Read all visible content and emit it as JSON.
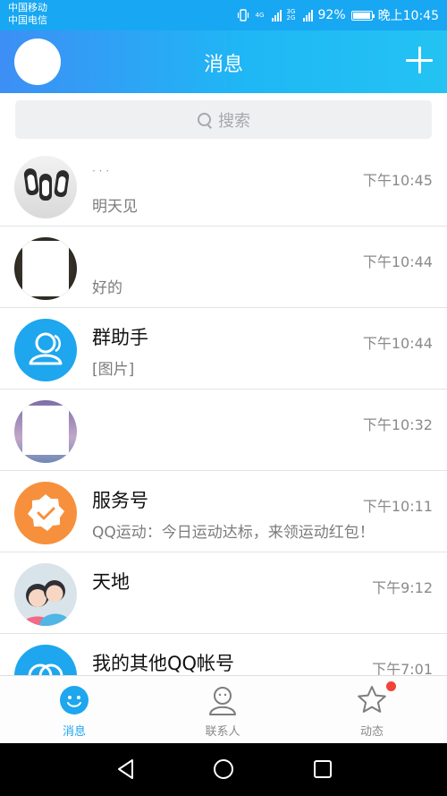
{
  "status_bar": {
    "carrier1": "中国移动",
    "carrier2": "中国电信",
    "net1": "4G",
    "net2": "3G",
    "net2b": "2G",
    "battery": "92%",
    "time": "晚上10:45"
  },
  "header": {
    "title": "消息"
  },
  "search": {
    "placeholder": "搜索"
  },
  "conversations": [
    {
      "name": "· · ·",
      "message": "明天见",
      "time": "下午10:45"
    },
    {
      "name": "",
      "message": "好的",
      "time": "下午10:44"
    },
    {
      "name": "群助手",
      "message": "[图片]",
      "time": "下午10:44"
    },
    {
      "name": "",
      "message": "",
      "time": "下午10:32"
    },
    {
      "name": "服务号",
      "message": "QQ运动：今日运动达标，来领运动红包！",
      "time": "下午10:11"
    },
    {
      "name": "天地",
      "message": "",
      "time": "下午9:12"
    },
    {
      "name": "我的其他QQ帐号",
      "message": "",
      "time": "下午7:01"
    }
  ],
  "tabs": [
    {
      "label": "消息"
    },
    {
      "label": "联系人"
    },
    {
      "label": "动态"
    }
  ],
  "colors": {
    "accent": "#1ea6ee",
    "header_start": "#3d8ff5",
    "header_end": "#23c3f3",
    "badge": "#f2423a",
    "service_orange": "#f7903c"
  }
}
